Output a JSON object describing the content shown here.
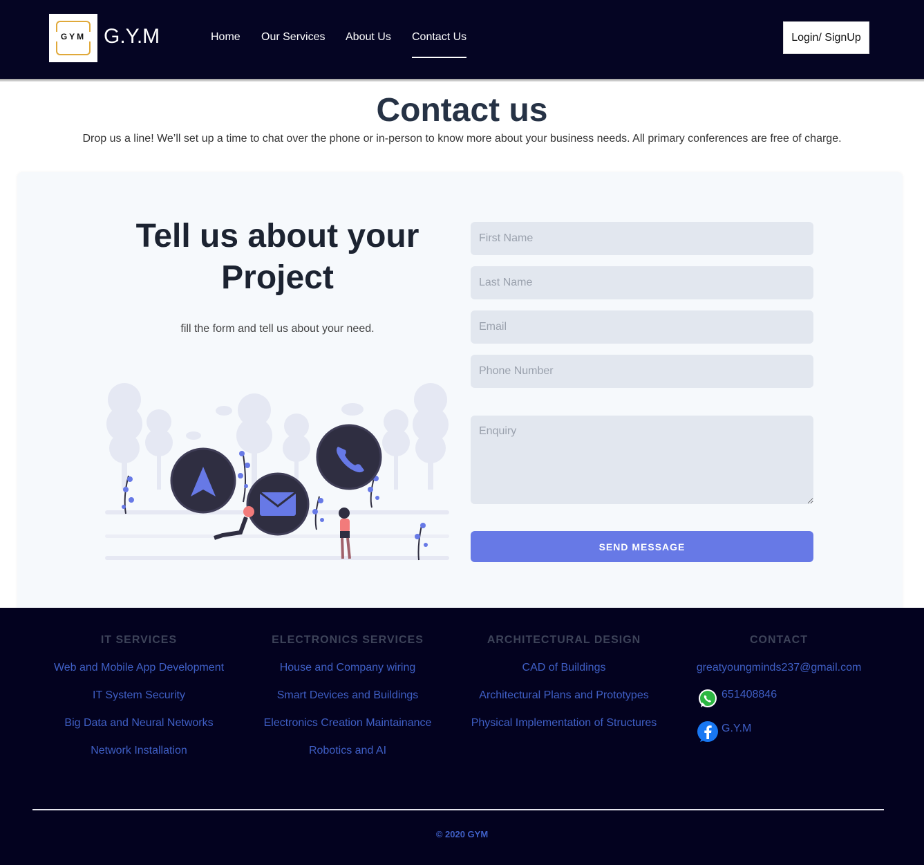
{
  "header": {
    "logo_text": "GYM",
    "brand": "G.Y.M",
    "nav": [
      "Home",
      "Our Services",
      "About Us",
      "Contact Us"
    ],
    "active_nav": "Contact Us",
    "login_label": "Login/ SignUp"
  },
  "contact": {
    "title": "Contact us",
    "intro": "Drop us a line! We’ll set up a time to chat over the phone or in-person to know more about your business needs. All primary conferences are free of charge."
  },
  "card": {
    "title": "Tell us about your Project",
    "subtitle": "fill the form and tell us about your need."
  },
  "form": {
    "first_name_placeholder": "First Name",
    "last_name_placeholder": "Last Name",
    "email_placeholder": "Email",
    "phone_placeholder": "Phone Number",
    "enquiry_placeholder": "Enquiry",
    "send_label": "SEND MESSAGE"
  },
  "footer": {
    "columns": [
      {
        "heading": "IT SERVICES",
        "links": [
          "Web and Mobile App Development",
          "IT System Security",
          "Big Data and Neural Networks",
          "Network Installation"
        ]
      },
      {
        "heading": "ELECTRONICS SERVICES",
        "links": [
          "House and Company wiring",
          "Smart Devices and Buildings",
          "Electronics Creation Maintainance",
          "Robotics and AI"
        ]
      },
      {
        "heading": "ARCHITECTURAL DESIGN",
        "links": [
          "CAD of Buildings",
          "Architectural Plans and Prototypes",
          "Physical Implementation of Structures"
        ]
      }
    ],
    "contact": {
      "heading": "CONTACT",
      "email": "greatyoungminds237@gmail.com",
      "phone": "651408846",
      "facebook": "G.Y.M"
    },
    "copyright": "© 2020 GYM"
  },
  "colors": {
    "header_bg": "#050523",
    "accent": "#6779e6",
    "footer_bg": "#03021f",
    "footer_link": "#3f5fc5"
  }
}
